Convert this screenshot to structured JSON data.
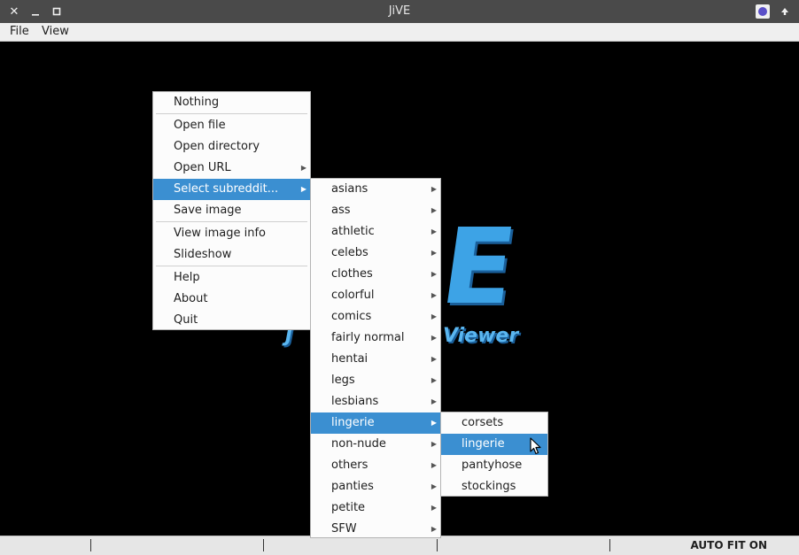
{
  "window": {
    "title": "JiVE"
  },
  "menubar": {
    "file": "File",
    "view": "View"
  },
  "logo": {
    "left_text": "J",
    "right_text": "Viewer"
  },
  "context_menu": {
    "items": [
      {
        "label": "Nothing"
      },
      {
        "label": "Open file"
      },
      {
        "label": "Open directory"
      },
      {
        "label": "Open URL"
      },
      {
        "label": "Select subreddit..."
      },
      {
        "label": "Save image"
      },
      {
        "label": "View image info"
      },
      {
        "label": "Slideshow"
      },
      {
        "label": "Help"
      },
      {
        "label": "About"
      },
      {
        "label": "Quit"
      }
    ]
  },
  "subreddit_menu": {
    "items": [
      {
        "label": "asians"
      },
      {
        "label": "ass"
      },
      {
        "label": "athletic"
      },
      {
        "label": "celebs"
      },
      {
        "label": "clothes"
      },
      {
        "label": "colorful"
      },
      {
        "label": "comics"
      },
      {
        "label": "fairly normal"
      },
      {
        "label": "hentai"
      },
      {
        "label": "legs"
      },
      {
        "label": "lesbians"
      },
      {
        "label": "lingerie"
      },
      {
        "label": "non-nude"
      },
      {
        "label": "others"
      },
      {
        "label": "panties"
      },
      {
        "label": "petite"
      },
      {
        "label": "SFW"
      }
    ]
  },
  "lingerie_menu": {
    "items": [
      {
        "label": "corsets"
      },
      {
        "label": "lingerie"
      },
      {
        "label": "pantyhose"
      },
      {
        "label": "stockings"
      }
    ]
  },
  "statusbar": {
    "status": "AUTO FIT ON"
  },
  "colors": {
    "highlight": "#3b8fd1",
    "logo_blue": "#3da3e6"
  },
  "icons": [
    "close-icon",
    "minimize-icon",
    "maximize-icon",
    "app-icon",
    "keep-above-icon",
    "submenu-arrow-icon",
    "mouse-cursor-icon"
  ]
}
